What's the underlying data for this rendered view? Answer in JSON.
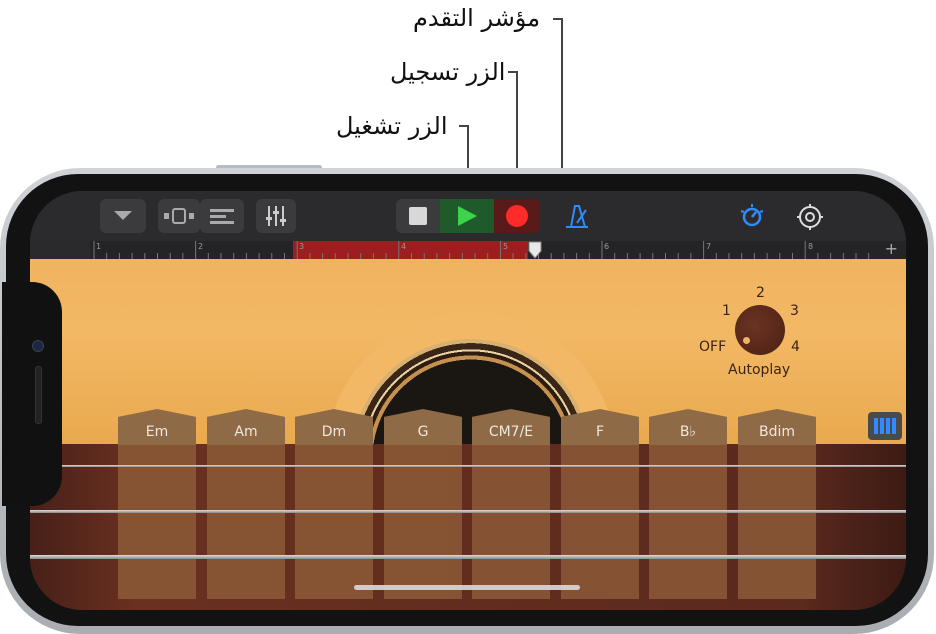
{
  "callouts": {
    "playhead": "مؤشر التقدم",
    "record": "الزر تسجيل",
    "play": "الزر تشغيل"
  },
  "ruler": {
    "bars": [
      "1",
      "2",
      "3",
      "4",
      "5",
      "6",
      "7",
      "8"
    ],
    "add": "+"
  },
  "chords": [
    "Em",
    "Am",
    "Dm",
    "G",
    "CM7/E",
    "F",
    "B♭",
    "Bdim"
  ],
  "autoplay": {
    "label": "Autoplay",
    "off": "OFF",
    "one": "1",
    "two": "2",
    "three": "3",
    "four": "4"
  },
  "colors": {
    "play": "#3cd44c",
    "record": "#ff2a2a",
    "accent": "#2f8cff"
  },
  "icons": [
    "chevron-down-icon",
    "browser-icon",
    "tracks-icon",
    "mixer-icon",
    "stop-icon",
    "play-icon",
    "record-icon",
    "metronome-icon",
    "master-effects-icon",
    "settings-icon",
    "chord-strips-icon"
  ]
}
